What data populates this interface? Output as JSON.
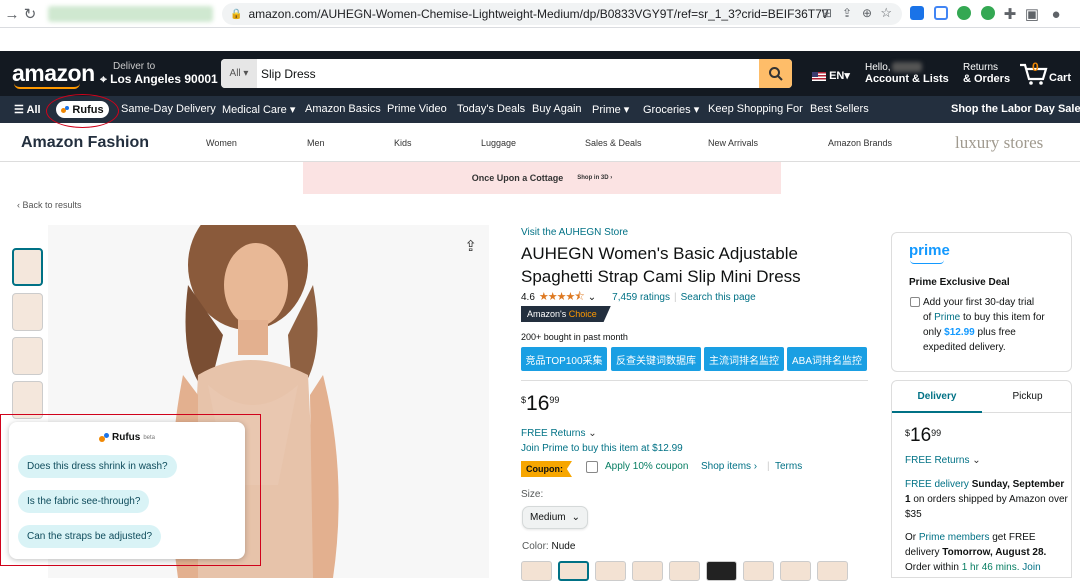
{
  "browser": {
    "url": "amazon.com/AUHEGN-Women-Chemise-Lightweight-Medium/dp/B0833VGY9T/ref=sr_1_3?crid=BEIF36T7WT6Y&..."
  },
  "header": {
    "logo": "amazon",
    "deliver_to_label": "Deliver to",
    "deliver_to_location": "Los Angeles 90001",
    "search_category": "All",
    "search_value": "Slip Dress",
    "language": "EN",
    "account_greeting": "Hello,",
    "account_label": "Account & Lists",
    "returns_label": "Returns",
    "orders_label": "& Orders",
    "cart_count": "0",
    "cart_label": "Cart"
  },
  "subnav": {
    "all": "All",
    "rufus": "Rufus",
    "items": [
      "Same-Day Delivery",
      "Medical Care",
      "Amazon Basics",
      "Prime Video",
      "Today's Deals",
      "Buy Again",
      "Prime",
      "Groceries",
      "Keep Shopping For",
      "Best Sellers"
    ],
    "promo": "Shop the Labor Day Sale"
  },
  "fashion": {
    "title": "Amazon Fashion",
    "links": [
      "Women",
      "Men",
      "Kids",
      "Luggage",
      "Sales & Deals",
      "New Arrivals",
      "Amazon Brands"
    ],
    "luxury": "luxury stores"
  },
  "banner": {
    "brand": "Once Upon a Cottage",
    "cta": "Shop in 3D ›"
  },
  "back_link": "‹ Back to results",
  "rufus_panel": {
    "title": "Rufus",
    "badge": "beta",
    "questions": [
      "Does this dress shrink in wash?",
      "Is the fabric see-through?",
      "Can the straps be adjusted?"
    ]
  },
  "product": {
    "store_link": "Visit the AUHEGN Store",
    "title_line1": "AUHEGN Women's Basic Adjustable",
    "title_line2": "Spaghetti Strap Cami Slip Mini Dress",
    "rating": "4.6",
    "ratings_count": "7,459 ratings",
    "search_page": "Search this page",
    "choice_badge_prefix": "Amazon's",
    "choice_badge_suffix": "Choice",
    "bought": "200+ bought in past month",
    "tool_buttons": [
      "竞品TOP100采集",
      "反查关键词数据库",
      "主流词排名监控",
      "ABA词排名监控"
    ],
    "price_symbol": "$",
    "price_whole": "16",
    "price_fraction": "99",
    "free_returns": "FREE Returns",
    "join_prime": "Join Prime to buy this item at $12.99",
    "coupon_label": "Coupon:",
    "coupon_text": "Apply 10% coupon",
    "shop_items": "Shop items ›",
    "terms": "Terms",
    "size_label": "Size:",
    "size_value": "Medium",
    "color_label": "Color:",
    "color_value": "Nude"
  },
  "prime_box": {
    "logo": "prime",
    "title": "Prime Exclusive Deal",
    "line1": "Add your first 30-day trial",
    "line2_pre": "of",
    "line2_link": "Prime",
    "line2_post": "to buy this item for",
    "line3_pre": "only",
    "line3_price": "$12.99",
    "line3_post": "plus free",
    "line4": "expedited delivery."
  },
  "buy_box": {
    "tab_delivery": "Delivery",
    "tab_pickup": "Pickup",
    "price_symbol": "$",
    "price_whole": "16",
    "price_fraction": "99",
    "free_returns": "FREE Returns",
    "free_delivery": "FREE delivery",
    "delivery_date": "Sunday, September 1",
    "delivery_rest": "on orders shipped by Amazon over $35",
    "or": "Or",
    "prime_members": "Prime members",
    "fastest": "get FREE delivery",
    "fastest_date": "Tomorrow, August 28.",
    "order_within": "Order within",
    "countdown": "1 hr 46 mins.",
    "join": "Join"
  },
  "colors": {
    "nav_bg": "#131921",
    "subnav_bg": "#232f3e",
    "link": "#007185",
    "search_button": "#febd69",
    "highlight_red": "#d0021b"
  }
}
